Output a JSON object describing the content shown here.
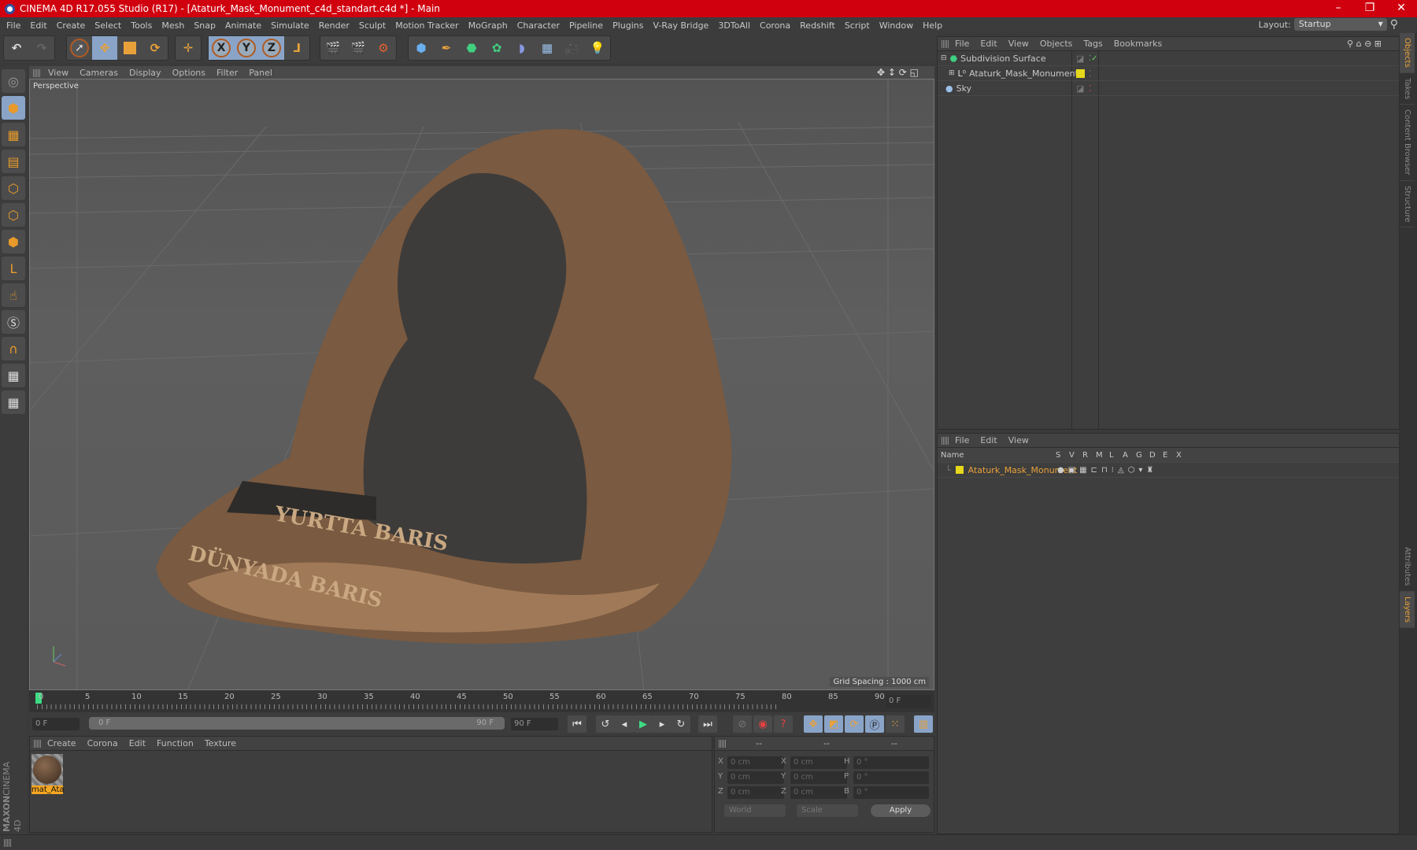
{
  "window": {
    "title": "CINEMA 4D R17.055 Studio (R17) - [Ataturk_Mask_Monument_c4d_standart.c4d *] - Main",
    "minimize": "–",
    "restore": "❐",
    "close": "✕"
  },
  "menu": [
    "File",
    "Edit",
    "Create",
    "Select",
    "Tools",
    "Mesh",
    "Snap",
    "Animate",
    "Simulate",
    "Render",
    "Sculpt",
    "Motion Tracker",
    "MoGraph",
    "Character",
    "Pipeline",
    "Plugins",
    "V-Ray Bridge",
    "3DToAll",
    "Corona",
    "Redshift",
    "Script",
    "Window",
    "Help"
  ],
  "layout": {
    "label": "Layout:",
    "value": "Startup"
  },
  "toolbar": {
    "x": "X",
    "y": "Y",
    "z": "Z"
  },
  "viewport": {
    "menu": [
      "View",
      "Cameras",
      "Display",
      "Options",
      "Filter",
      "Panel"
    ],
    "camera": "Perspective",
    "grid_spacing": "Grid Spacing : 1000 cm",
    "model_text_1": "YURTTA BARIS",
    "model_text_2": "DÜNYADA BARIS"
  },
  "timeline": {
    "ticks": [
      "0",
      "5",
      "10",
      "15",
      "20",
      "25",
      "30",
      "35",
      "40",
      "45",
      "50",
      "55",
      "60",
      "65",
      "70",
      "75",
      "80",
      "85",
      "90"
    ],
    "current_frame": "0 F",
    "start": "0 F",
    "range_start": "0 F",
    "range_end": "90 F",
    "end": "90 F"
  },
  "materials": {
    "menu": [
      "Create",
      "Corona",
      "Edit",
      "Function",
      "Texture"
    ],
    "items": [
      {
        "name": "mat_Ata"
      }
    ],
    "brand_1": "MAXON",
    "brand_2": "CINEMA 4D"
  },
  "coords": {
    "headers": [
      "--",
      "--",
      "--"
    ],
    "rows": [
      {
        "a": "X",
        "av": "0 cm",
        "b": "X",
        "bv": "0 cm",
        "c": "H",
        "cv": "0 °"
      },
      {
        "a": "Y",
        "av": "0 cm",
        "b": "Y",
        "bv": "0 cm",
        "c": "P",
        "cv": "0 °"
      },
      {
        "a": "Z",
        "av": "0 cm",
        "b": "Z",
        "bv": "0 cm",
        "c": "B",
        "cv": "0 °"
      }
    ],
    "mode": "World",
    "transform": "Scale",
    "apply": "Apply"
  },
  "objects": {
    "menu": [
      "File",
      "Edit",
      "View",
      "Objects",
      "Tags",
      "Bookmarks"
    ],
    "items": [
      {
        "name": "Subdivision Surface"
      },
      {
        "name": "Ataturk_Mask_Monument"
      },
      {
        "name": "Sky"
      }
    ]
  },
  "layers": {
    "menu": [
      "File",
      "Edit",
      "View"
    ],
    "columns": [
      "Name",
      "S",
      "V",
      "R",
      "M",
      "L",
      "A",
      "G",
      "D",
      "E",
      "X"
    ],
    "items": [
      {
        "name": "Ataturk_Mask_Monument",
        "color": "#e6d81a"
      }
    ]
  },
  "side_tabs": [
    "Objects",
    "Takes",
    "Content Browser",
    "Structure",
    "Attributes",
    "Layers"
  ],
  "colors": {
    "title": "#d0000f",
    "accent": "#e8a13a",
    "active": "#8aa4c8"
  }
}
